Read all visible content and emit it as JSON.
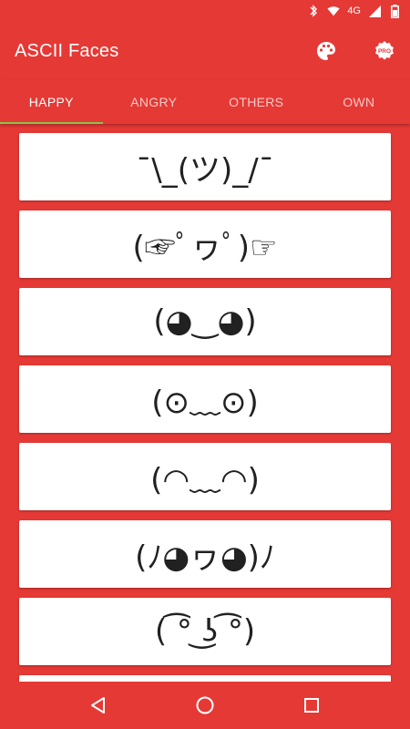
{
  "status_bar": {
    "network": "4G",
    "icons": [
      "bluetooth-icon",
      "wifi-icon",
      "signal-icon",
      "battery-icon"
    ]
  },
  "app_bar": {
    "title": "ASCII Faces",
    "actions": [
      {
        "name": "palette-icon"
      },
      {
        "name": "pro-badge-icon",
        "label": "PRO"
      }
    ]
  },
  "tabs": [
    {
      "label": "HAPPY",
      "active": true
    },
    {
      "label": "ANGRY",
      "active": false
    },
    {
      "label": "OTHERS",
      "active": false
    },
    {
      "label": "OWN",
      "active": false
    }
  ],
  "faces": [
    "¯\\_(ツ)_/¯",
    "(☞ﾟヮﾟ)☞",
    "(◕‿◕)",
    "(⊙﹏⊙)",
    "(◠﹏◠)",
    "(ﾉ◕ヮ◕)ﾉ",
    "( ͡° ͜ʖ ͡°)"
  ],
  "nav_bar": {
    "buttons": [
      "back-icon",
      "home-icon",
      "recents-icon"
    ]
  },
  "colors": {
    "primary": "#E53935",
    "tab_indicator": "#8BC34A",
    "card": "#FFFFFF",
    "text": "#212121"
  }
}
